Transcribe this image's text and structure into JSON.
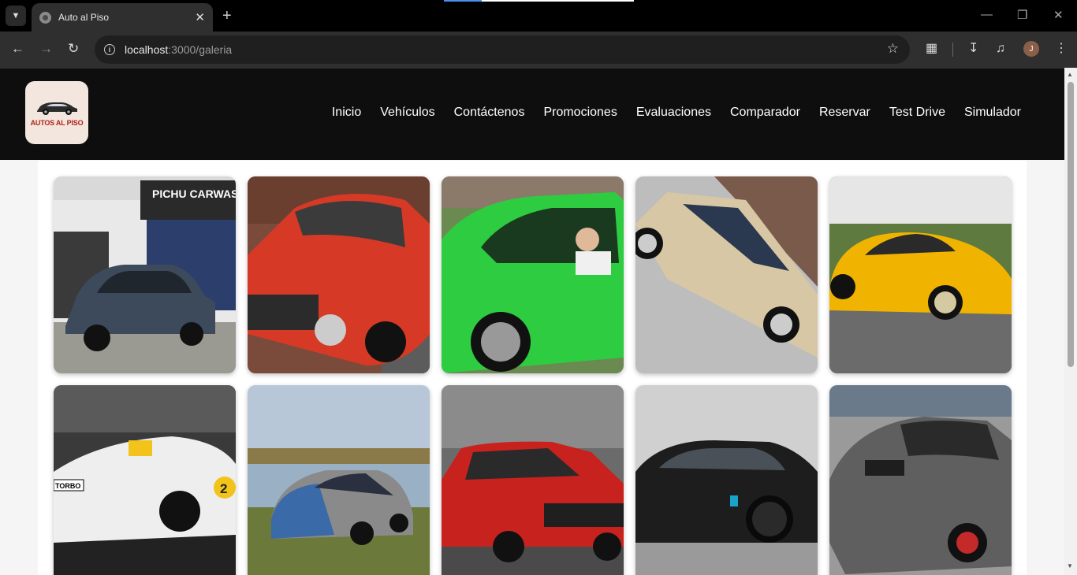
{
  "browser": {
    "tab_title": "Auto al Piso",
    "url_host": "localhost",
    "url_path": ":3000/galeria",
    "profile_initial": "J"
  },
  "site": {
    "logo_text": "AUTOS AL PISO",
    "nav": [
      "Inicio",
      "Vehículos",
      "Contáctenos",
      "Promociones",
      "Evaluaciones",
      "Comparador",
      "Reservar",
      "Test Drive",
      "Simulador"
    ]
  },
  "gallery": {
    "sign_text": "PICHU CARWASH",
    "plate_text": "TORBO",
    "race_number": "2",
    "images": [
      {
        "name": "grey-sedan-carwash",
        "color": "#3d4a5c"
      },
      {
        "name": "red-coupe",
        "color": "#d63a26"
      },
      {
        "name": "green-classic",
        "color": "#2ecc40"
      },
      {
        "name": "beige-wagon",
        "color": "#d8c7a4"
      },
      {
        "name": "yellow-hatchback",
        "color": "#f0b400"
      },
      {
        "name": "white-race-car",
        "color": "#eeeeee"
      },
      {
        "name": "blue-hatchback-lake",
        "color": "#3a6aa8"
      },
      {
        "name": "red-classic-hatch",
        "color": "#c8221f"
      },
      {
        "name": "black-lowered-coupe",
        "color": "#1d1d1d"
      },
      {
        "name": "grey-tuned-hatch",
        "color": "#5f5f5f"
      }
    ]
  }
}
